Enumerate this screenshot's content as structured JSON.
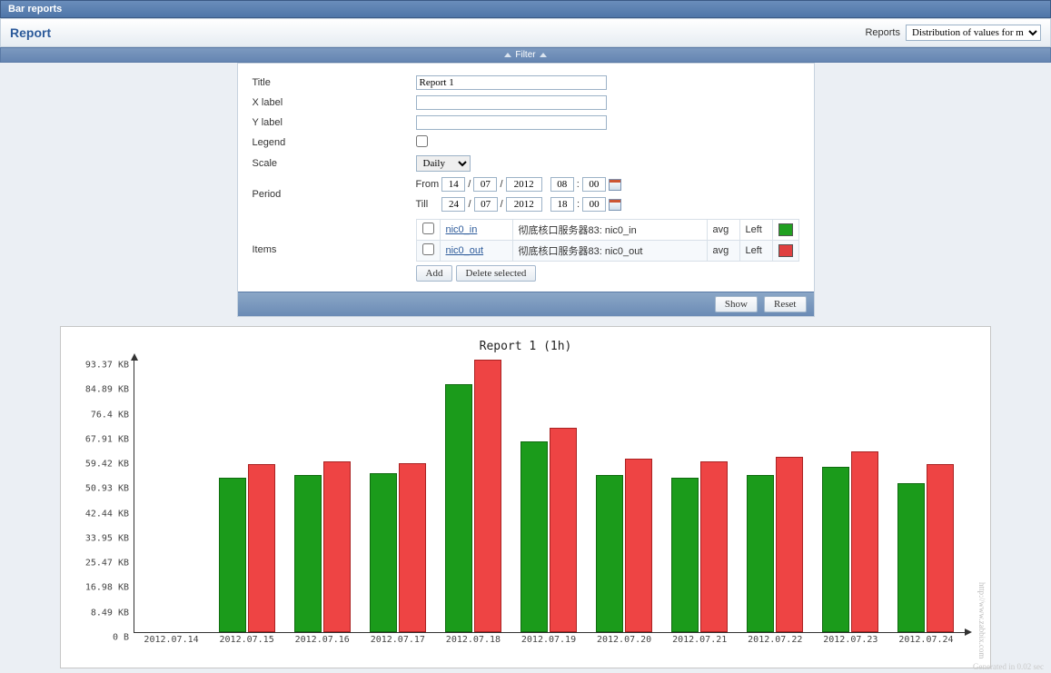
{
  "topbar": {
    "title": "Bar reports"
  },
  "subbar": {
    "title": "Report",
    "reports_label": "Reports",
    "reports_select": "Distribution of values for m"
  },
  "filter": {
    "header": "Filter",
    "title_label": "Title",
    "title_value": "Report 1",
    "xlabel_label": "X label",
    "xlabel_value": "",
    "ylabel_label": "Y label",
    "ylabel_value": "",
    "legend_label": "Legend",
    "scale_label": "Scale",
    "scale_value": "Daily",
    "period_label": "Period",
    "from_label": "From",
    "from_d": "14",
    "from_m": "07",
    "from_y": "2012",
    "from_h": "08",
    "from_min": "00",
    "till_label": "Till",
    "till_d": "24",
    "till_m": "07",
    "till_y": "2012",
    "till_h": "18",
    "till_min": "00",
    "items_label": "Items",
    "items": [
      {
        "name": "nic0_in",
        "host": "彻底核口服务器83: nic0_in",
        "func": "avg",
        "axis": "Left",
        "color": "green"
      },
      {
        "name": "nic0_out",
        "host": "彻底核口服务器83: nic0_out",
        "func": "avg",
        "axis": "Left",
        "color": "red"
      }
    ],
    "add_btn": "Add",
    "delete_btn": "Delete selected",
    "show_btn": "Show",
    "reset_btn": "Reset"
  },
  "chart_data": {
    "type": "bar",
    "title": "Report 1 (1h)",
    "ylabel": "",
    "yticks": [
      "0 B",
      "8.49 KB",
      "16.98 KB",
      "25.47 KB",
      "33.95 KB",
      "42.44 KB",
      "50.93 KB",
      "59.42 KB",
      "67.91 KB",
      "76.4 KB",
      "84.89 KB",
      "93.37 KB"
    ],
    "ylim_kb": [
      0,
      93.37
    ],
    "categories": [
      "2012.07.14",
      "2012.07.15",
      "2012.07.16",
      "2012.07.17",
      "2012.07.18",
      "2012.07.19",
      "2012.07.20",
      "2012.07.21",
      "2012.07.22",
      "2012.07.23",
      "2012.07.24"
    ],
    "series": [
      {
        "name": "nic0_in",
        "color": "green",
        "values_kb": [
          0,
          53.0,
          54.0,
          54.5,
          85.0,
          65.5,
          54.0,
          53.0,
          54.0,
          56.5,
          51.0
        ]
      },
      {
        "name": "nic0_out",
        "color": "red",
        "values_kb": [
          0,
          57.5,
          58.5,
          58.0,
          93.37,
          70.0,
          59.5,
          58.5,
          60.0,
          62.0,
          57.5
        ]
      }
    ]
  },
  "footer": {
    "generated": "Generated in 0.02 sec",
    "watermark": "http://www.zabbix.com"
  }
}
